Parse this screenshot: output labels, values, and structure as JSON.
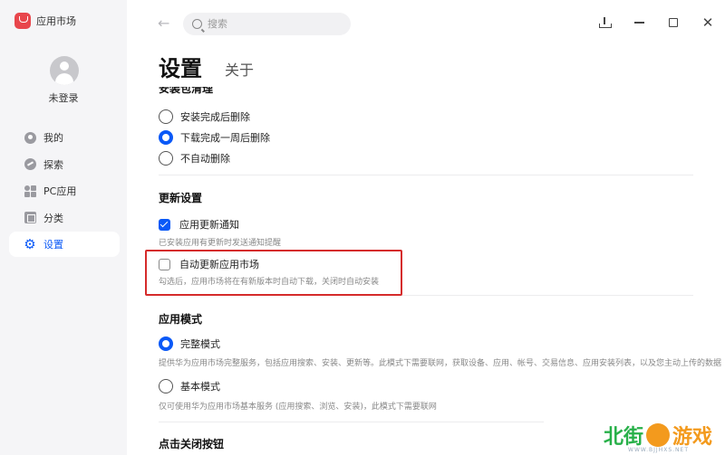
{
  "app": {
    "title": "应用市场",
    "brand_color": "#e8464c"
  },
  "user": {
    "status": "未登录"
  },
  "sidebar": {
    "items": [
      {
        "label": "我的",
        "icon": "person-icon",
        "active": false
      },
      {
        "label": "探索",
        "icon": "compass-icon",
        "active": false
      },
      {
        "label": "PC应用",
        "icon": "grid-apps-icon",
        "active": false
      },
      {
        "label": "分类",
        "icon": "category-icon",
        "active": false
      },
      {
        "label": "设置",
        "icon": "gear-icon",
        "active": true
      }
    ],
    "accent": "#0a59f7"
  },
  "toolbar": {
    "search_placeholder": "搜索"
  },
  "page": {
    "tab_active": "设置",
    "tab_other": "关于"
  },
  "settings": {
    "install_cleanup": {
      "title": "安装包清理",
      "options": [
        {
          "label": "安装完成后删除",
          "selected": false
        },
        {
          "label": "下载完成一周后删除",
          "selected": true
        },
        {
          "label": "不自动删除",
          "selected": false
        }
      ]
    },
    "update": {
      "title": "更新设置",
      "notify": {
        "label": "应用更新通知",
        "checked": true,
        "hint": "已安装应用有更新时发送通知提醒"
      },
      "auto_update": {
        "label": "自动更新应用市场",
        "checked": false,
        "hint": "勾选后，应用市场将在有新版本时自动下载，关闭时自动安装"
      }
    },
    "mode": {
      "title": "应用模式",
      "full": {
        "label": "完整模式",
        "selected": true,
        "hint": "提供华为应用市场完整服务，包括应用搜索、安装、更新等。此模式下需要联网，获取设备、应用、帐号、交易信息、应用安装列表，以及您主动上传的数据"
      },
      "basic": {
        "label": "基本模式",
        "selected": false,
        "hint": "仅可使用华为应用市场基本服务 (应用搜索、浏览、安装)，此模式下需要联网"
      }
    },
    "close_button": {
      "title": "点击关闭按钮"
    }
  },
  "highlight_color": "#d52b2b",
  "watermark": {
    "text_green": "北街",
    "text_orange": "游戏",
    "url": "WWW.BJJHXS.NET"
  }
}
